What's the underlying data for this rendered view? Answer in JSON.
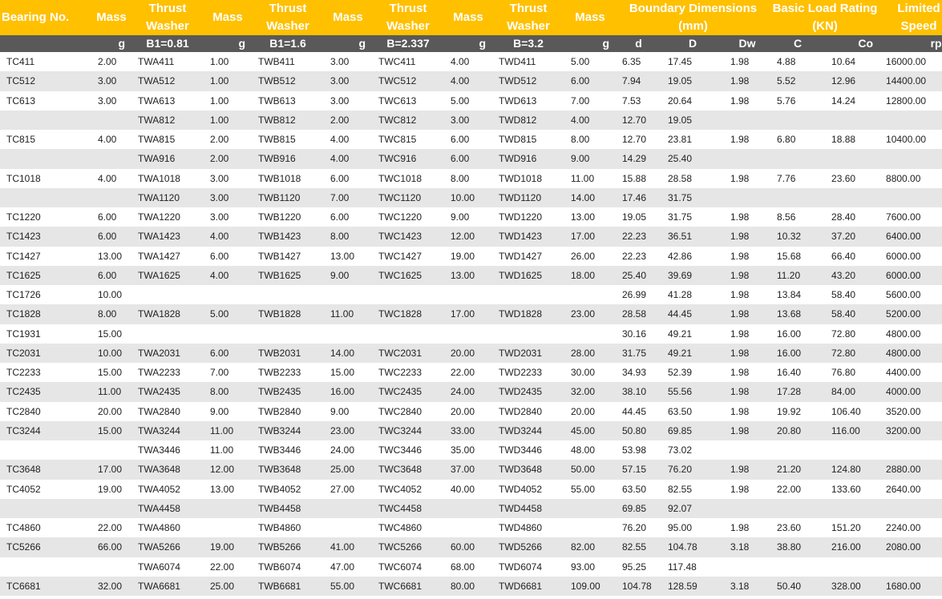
{
  "header": {
    "bearing_no": "Bearing No.",
    "mass": "Mass",
    "thrust": "Thrust",
    "washer": "Washer",
    "boundary": "Boundary Dimensions",
    "boundary_unit": "(mm)",
    "load_rating": "Basic Load Rating",
    "load_unit": "(KN)",
    "limited": "Limited",
    "speed": "Speed"
  },
  "units": [
    "",
    "g",
    "B1=0.81",
    "g",
    "B1=1.6",
    "g",
    "B=2.337",
    "g",
    "B=3.2",
    "g",
    "d",
    "D",
    "Dw",
    "C",
    "Co",
    "rpm"
  ],
  "rows": [
    [
      "TC411",
      "2.00",
      "TWA411",
      "1.00",
      "TWB411",
      "3.00",
      "TWC411",
      "4.00",
      "TWD411",
      "5.00",
      "6.35",
      "17.45",
      "1.98",
      "4.88",
      "10.64",
      "16000.00"
    ],
    [
      "TC512",
      "3.00",
      "TWA512",
      "1.00",
      "TWB512",
      "3.00",
      "TWC512",
      "4.00",
      "TWD512",
      "6.00",
      "7.94",
      "19.05",
      "1.98",
      "5.52",
      "12.96",
      "14400.00"
    ],
    [
      "TC613",
      "3.00",
      "TWA613",
      "1.00",
      "TWB613",
      "3.00",
      "TWC613",
      "5.00",
      "TWD613",
      "7.00",
      "7.53",
      "20.64",
      "1.98",
      "5.76",
      "14.24",
      "12800.00"
    ],
    [
      "",
      "",
      "TWA812",
      "1.00",
      "TWB812",
      "2.00",
      "TWC812",
      "3.00",
      "TWD812",
      "4.00",
      "12.70",
      "19.05",
      "",
      "",
      "",
      ""
    ],
    [
      "TC815",
      "4.00",
      "TWA815",
      "2.00",
      "TWB815",
      "4.00",
      "TWC815",
      "6.00",
      "TWD815",
      "8.00",
      "12.70",
      "23.81",
      "1.98",
      "6.80",
      "18.88",
      "10400.00"
    ],
    [
      "",
      "",
      "TWA916",
      "2.00",
      "TWB916",
      "4.00",
      "TWC916",
      "6.00",
      "TWD916",
      "9.00",
      "14.29",
      "25.40",
      "",
      "",
      "",
      ""
    ],
    [
      "TC1018",
      "4.00",
      "TWA1018",
      "3.00",
      "TWB1018",
      "6.00",
      "TWC1018",
      "8.00",
      "TWD1018",
      "11.00",
      "15.88",
      "28.58",
      "1.98",
      "7.76",
      "23.60",
      "8800.00"
    ],
    [
      "",
      "",
      "TWA1120",
      "3.00",
      "TWB1120",
      "7.00",
      "TWC1120",
      "10.00",
      "TWD1120",
      "14.00",
      "17.46",
      "31.75",
      "",
      "",
      "",
      ""
    ],
    [
      "TC1220",
      "6.00",
      "TWA1220",
      "3.00",
      "TWB1220",
      "6.00",
      "TWC1220",
      "9.00",
      "TWD1220",
      "13.00",
      "19.05",
      "31.75",
      "1.98",
      "8.56",
      "28.40",
      "7600.00"
    ],
    [
      "TC1423",
      "6.00",
      "TWA1423",
      "4.00",
      "TWB1423",
      "8.00",
      "TWC1423",
      "12.00",
      "TWD1423",
      "17.00",
      "22.23",
      "36.51",
      "1.98",
      "10.32",
      "37.20",
      "6400.00"
    ],
    [
      "TC1427",
      "13.00",
      "TWA1427",
      "6.00",
      "TWB1427",
      "13.00",
      "TWC1427",
      "19.00",
      "TWD1427",
      "26.00",
      "22.23",
      "42.86",
      "1.98",
      "15.68",
      "66.40",
      "6000.00"
    ],
    [
      "TC1625",
      "6.00",
      "TWA1625",
      "4.00",
      "TWB1625",
      "9.00",
      "TWC1625",
      "13.00",
      "TWD1625",
      "18.00",
      "25.40",
      "39.69",
      "1.98",
      "11.20",
      "43.20",
      "6000.00"
    ],
    [
      "TC1726",
      "10.00",
      "",
      "",
      "",
      "",
      "",
      "",
      "",
      "",
      "26.99",
      "41.28",
      "1.98",
      "13.84",
      "58.40",
      "5600.00"
    ],
    [
      "TC1828",
      "8.00",
      "TWA1828",
      "5.00",
      "TWB1828",
      "11.00",
      "TWC1828",
      "17.00",
      "TWD1828",
      "23.00",
      "28.58",
      "44.45",
      "1.98",
      "13.68",
      "58.40",
      "5200.00"
    ],
    [
      "TC1931",
      "15.00",
      "",
      "",
      "",
      "",
      "",
      "",
      "",
      "",
      "30.16",
      "49.21",
      "1.98",
      "16.00",
      "72.80",
      "4800.00"
    ],
    [
      "TC2031",
      "10.00",
      "TWA2031",
      "6.00",
      "TWB2031",
      "14.00",
      "TWC2031",
      "20.00",
      "TWD2031",
      "28.00",
      "31.75",
      "49.21",
      "1.98",
      "16.00",
      "72.80",
      "4800.00"
    ],
    [
      "TC2233",
      "15.00",
      "TWA2233",
      "7.00",
      "TWB2233",
      "15.00",
      "TWC2233",
      "22.00",
      "TWD2233",
      "30.00",
      "34.93",
      "52.39",
      "1.98",
      "16.40",
      "76.80",
      "4400.00"
    ],
    [
      "TC2435",
      "11.00",
      "TWA2435",
      "8.00",
      "TWB2435",
      "16.00",
      "TWC2435",
      "24.00",
      "TWD2435",
      "32.00",
      "38.10",
      "55.56",
      "1.98",
      "17.28",
      "84.00",
      "4000.00"
    ],
    [
      "TC2840",
      "20.00",
      "TWA2840",
      "9.00",
      "TWB2840",
      "9.00",
      "TWC2840",
      "20.00",
      "TWD2840",
      "20.00",
      "44.45",
      "63.50",
      "1.98",
      "19.92",
      "106.40",
      "3520.00"
    ],
    [
      "TC3244",
      "15.00",
      "TWA3244",
      "11.00",
      "TWB3244",
      "23.00",
      "TWC3244",
      "33.00",
      "TWD3244",
      "45.00",
      "50.80",
      "69.85",
      "1.98",
      "20.80",
      "116.00",
      "3200.00"
    ],
    [
      "",
      "",
      "TWA3446",
      "11.00",
      "TWB3446",
      "24.00",
      "TWC3446",
      "35.00",
      "TWD3446",
      "48.00",
      "53.98",
      "73.02",
      "",
      "",
      "",
      ""
    ],
    [
      "TC3648",
      "17.00",
      "TWA3648",
      "12.00",
      "TWB3648",
      "25.00",
      "TWC3648",
      "37.00",
      "TWD3648",
      "50.00",
      "57.15",
      "76.20",
      "1.98",
      "21.20",
      "124.80",
      "2880.00"
    ],
    [
      "TC4052",
      "19.00",
      "TWA4052",
      "13.00",
      "TWB4052",
      "27.00",
      "TWC4052",
      "40.00",
      "TWD4052",
      "55.00",
      "63.50",
      "82.55",
      "1.98",
      "22.00",
      "133.60",
      "2640.00"
    ],
    [
      "",
      "",
      "TWA4458",
      "",
      "TWB4458",
      "",
      "TWC4458",
      "",
      "TWD4458",
      "",
      "69.85",
      "92.07",
      "",
      "",
      "",
      ""
    ],
    [
      "TC4860",
      "22.00",
      "TWA4860",
      "",
      "TWB4860",
      "",
      "TWC4860",
      "",
      "TWD4860",
      "",
      "76.20",
      "95.00",
      "1.98",
      "23.60",
      "151.20",
      "2240.00"
    ],
    [
      "TC5266",
      "66.00",
      "TWA5266",
      "19.00",
      "TWB5266",
      "41.00",
      "TWC5266",
      "60.00",
      "TWD5266",
      "82.00",
      "82.55",
      "104.78",
      "3.18",
      "38.80",
      "216.00",
      "2080.00"
    ],
    [
      "",
      "",
      "TWA6074",
      "22.00",
      "TWB6074",
      "47.00",
      "TWC6074",
      "68.00",
      "TWD6074",
      "93.00",
      "95.25",
      "117.48",
      "",
      "",
      "",
      ""
    ],
    [
      "TC6681",
      "32.00",
      "TWA6681",
      "25.00",
      "TWB6681",
      "55.00",
      "TWC6681",
      "80.00",
      "TWD6681",
      "109.00",
      "104.78",
      "128.59",
      "3.18",
      "50.40",
      "328.00",
      "1680.00"
    ]
  ]
}
